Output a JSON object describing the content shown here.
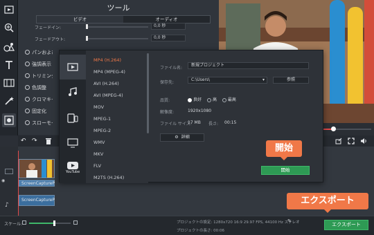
{
  "tools": {
    "title": "ツール",
    "tabs": [
      "ビデオ",
      "オーディオ"
    ],
    "sliders": [
      {
        "label": "フェードイン:",
        "value": "0,0 秒"
      },
      {
        "label": "フェードアウト:",
        "value": "0,0 秒"
      }
    ],
    "effects": [
      "パンおよび",
      "強調表示",
      "トリミング",
      "色調整",
      "クロマキー",
      "固定化",
      "スローモー"
    ]
  },
  "export": {
    "formats": [
      "MP4 (H.264)",
      "MP4 (MPEG-4)",
      "AVI (H.264)",
      "AVI (MPEG-4)",
      "MOV",
      "MPEG-1",
      "MPEG-2",
      "WMV",
      "MKV",
      "FLV",
      "M2TS (H.264)"
    ],
    "selected_format": "MP4 (H.264)",
    "filename_label": "ファイル名:",
    "filename": "新規プロジェクト",
    "save_to_label": "保存先:",
    "save_to": "C:\\Users\\",
    "browse_label": "参照",
    "quality_label": "品質:",
    "quality_options": [
      "良好",
      "高",
      "最高"
    ],
    "quality_selected": "良好",
    "resolution_label": "解像度:",
    "resolution": "1920x1080",
    "filesize_label": "ファイル サイズ:",
    "filesize": "17 MB",
    "length_label": "長さ:",
    "length": "00:15",
    "details_label": "詳細",
    "start_label": "開始",
    "youtube_label": "YouTube"
  },
  "callouts": {
    "start": "開始",
    "export": "エクスポート"
  },
  "timeline": {
    "clip_label": "ScreenCaptureP",
    "audio_clip_label": "ScreenCaptureP"
  },
  "footer": {
    "scale_label": "スケール:",
    "project_settings": "プロジェクトの設定:  1280x720 16:9 29.97 FPS, 44100 Hz ステレオ",
    "project_length": "プロジェクトの長さ:  00:06",
    "export_label": "エクスポート"
  },
  "colors": {
    "accent_orange": "#f07848",
    "export_green": "#2e9a54",
    "selected_format": "#f07848"
  }
}
